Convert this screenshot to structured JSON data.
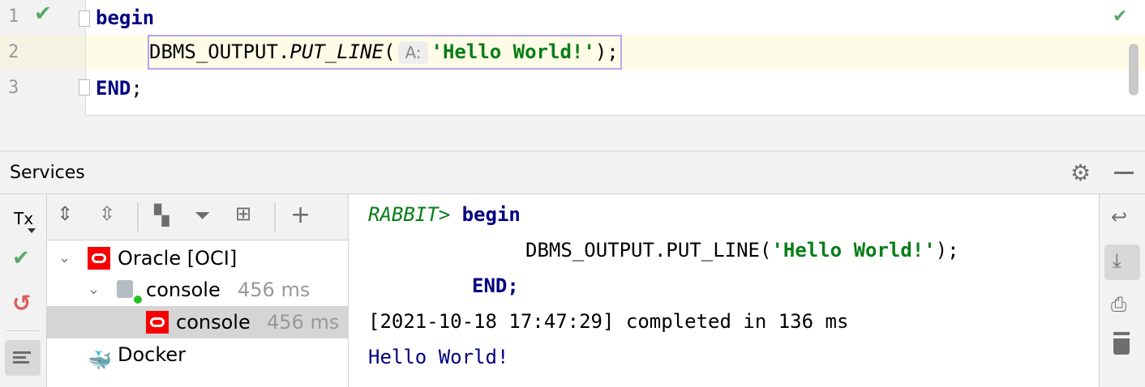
{
  "editor": {
    "lines": [
      {
        "number": "1",
        "kw": "begin"
      },
      {
        "number": "2",
        "call": "DBMS_OUTPUT.",
        "method": "PUT_LINE",
        "open": "(",
        "hint": "A:",
        "arg": "'Hello World!'",
        "close": ");"
      },
      {
        "number": "3",
        "kw": "END",
        ";": ";",
        "semi": ";"
      }
    ]
  },
  "services": {
    "title": "Services"
  },
  "left_toolbar": {
    "tx": "Tx"
  },
  "tree": [
    {
      "label": "Oracle [OCI]"
    },
    {
      "label": "console",
      "time": "456 ms"
    },
    {
      "label": "console",
      "time": "456 ms"
    },
    {
      "label": "Docker"
    }
  ],
  "console": {
    "prompt": "RABBIT>",
    "begin": "begin",
    "line2a": "DBMS_OUTPUT.PUT_LINE(",
    "line2str": "'Hello World!'",
    "line2b": ");",
    "end": "END;",
    "status": "[2021-10-18 17:47:29] completed in 136 ms",
    "output": "Hello World!"
  }
}
